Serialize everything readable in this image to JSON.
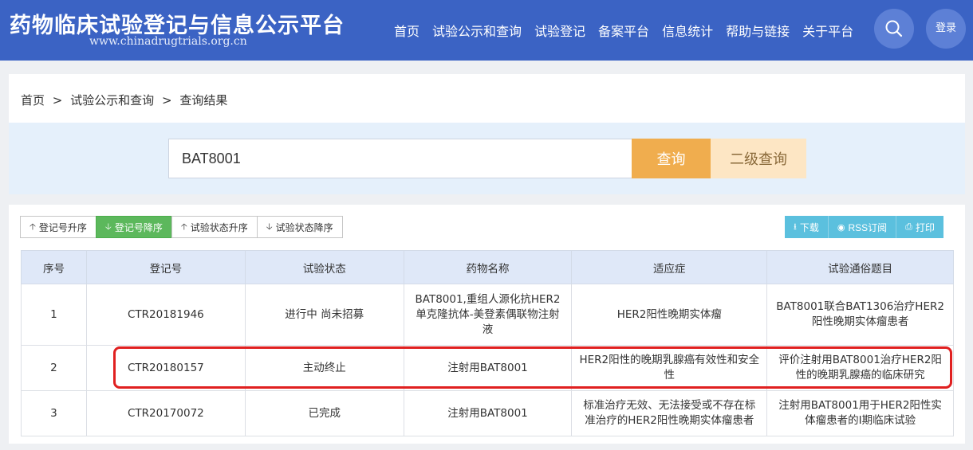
{
  "header": {
    "title": "药物临床试验登记与信息公示平台",
    "url": "www.chinadrugtrials.org.cn",
    "nav": [
      "首页",
      "试验公示和查询",
      "试验登记",
      "备案平台",
      "信息统计",
      "帮助与链接",
      "关于平台"
    ],
    "login": "登录",
    "icons": {
      "search": "search-icon"
    },
    "colors": {
      "bar": "#3b63c4"
    }
  },
  "breadcrumb": [
    "首页",
    "试验公示和查询",
    "查询结果"
  ],
  "breadcrumb_sep": ">",
  "search": {
    "value": "BAT8001",
    "query_label": "查询",
    "advanced_label": "二级查询"
  },
  "sort_buttons": [
    {
      "label": "登记号升序",
      "icon": "arrow-up-icon"
    },
    {
      "label": "登记号降序",
      "icon": "arrow-down-icon",
      "active": true
    },
    {
      "label": "试验状态升序",
      "icon": "arrow-up-icon"
    },
    {
      "label": "试验状态降序",
      "icon": "arrow-down-icon"
    }
  ],
  "tools": [
    {
      "label": "下载",
      "icon": "download-icon"
    },
    {
      "label": "RSS订阅",
      "icon": "rss-icon"
    },
    {
      "label": "打印",
      "icon": "print-icon"
    }
  ],
  "table": {
    "headers": [
      "序号",
      "登记号",
      "试验状态",
      "药物名称",
      "适应症",
      "试验通俗题目"
    ],
    "rows": [
      [
        "1",
        "CTR20181946",
        "进行中 尚未招募",
        "BAT8001,重组人源化抗HER2单克隆抗体-美登素偶联物注射液",
        "HER2阳性晚期实体瘤",
        "BAT8001联合BAT1306治疗HER2阳性晚期实体瘤患者"
      ],
      [
        "2",
        "CTR20180157",
        "主动终止",
        "注射用BAT8001",
        "HER2阳性的晚期乳腺癌有效性和安全性",
        "评价注射用BAT8001治疗HER2阳性的晚期乳腺癌的临床研究"
      ],
      [
        "3",
        "CTR20170072",
        "已完成",
        "注射用BAT8001",
        "标准治疗无效、无法接受或不存在标准治疗的HER2阳性晚期实体瘤患者",
        "注射用BAT8001用于HER2阳性实体瘤患者的Ⅰ期临床试验"
      ]
    ]
  }
}
